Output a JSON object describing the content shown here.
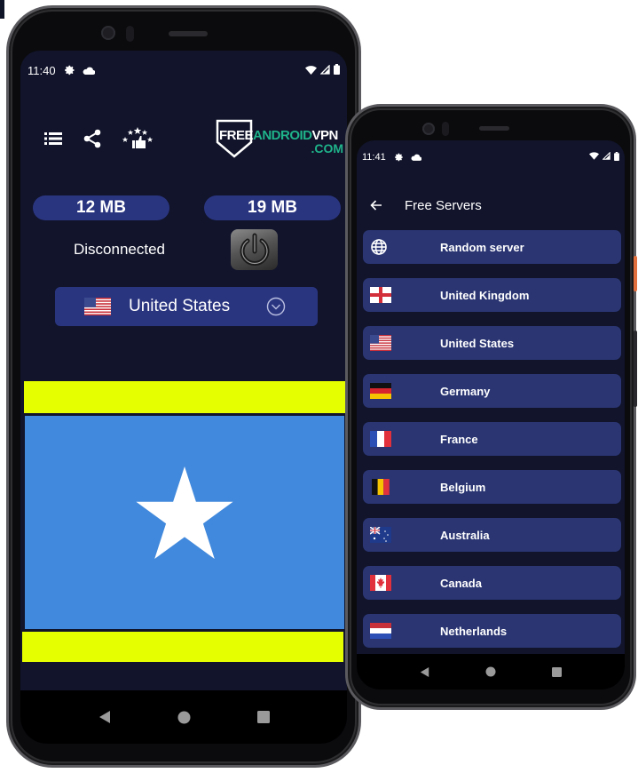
{
  "phone1": {
    "status_bar": {
      "time": "11:40",
      "icons": [
        "gear-icon",
        "cloud-icon"
      ],
      "right_icons": [
        "wifi-icon",
        "signal-icon",
        "battery-icon"
      ]
    },
    "toolbar": {
      "icons": [
        "menu-list-icon",
        "share-icon",
        "rate-stars-icon"
      ]
    },
    "logo": {
      "part1": "FREE",
      "part2": "ANDROID",
      "part3": "VPN",
      "suffix": ".COM"
    },
    "traffic": {
      "download": "12 MB",
      "upload": "19 MB"
    },
    "connection_status": "Disconnected",
    "power_button_icon": "power-icon",
    "selected_country": {
      "name": "United States",
      "flag": "us-flag"
    },
    "banner": {
      "colors": {
        "stripe": "#e6ff00",
        "field": "#4189dc",
        "star": "#ffffff"
      }
    },
    "nav": [
      "back",
      "home",
      "recents"
    ]
  },
  "phone2": {
    "status_bar": {
      "time": "11:41",
      "icons": [
        "gear-icon",
        "cloud-icon"
      ],
      "right_icons": [
        "wifi-icon",
        "signal-icon",
        "battery-icon"
      ]
    },
    "header": {
      "title": "Free Servers",
      "back_icon": "arrow-left-icon"
    },
    "servers": [
      {
        "name": "Random server",
        "icon": "globe-icon"
      },
      {
        "name": "United Kingdom",
        "icon": "uk-flag"
      },
      {
        "name": "United States",
        "icon": "us-flag"
      },
      {
        "name": "Germany",
        "icon": "germany-flag"
      },
      {
        "name": "France",
        "icon": "france-flag"
      },
      {
        "name": "Belgium",
        "icon": "belgium-flag"
      },
      {
        "name": "Australia",
        "icon": "australia-flag"
      },
      {
        "name": "Canada",
        "icon": "canada-flag"
      },
      {
        "name": "Netherlands",
        "icon": "netherlands-flag"
      }
    ],
    "nav": [
      "back",
      "home",
      "recents"
    ]
  },
  "colors": {
    "background": "#11142b",
    "card": "#2a3572",
    "pill": "#2a3580",
    "accent_green": "#1fb38a"
  }
}
